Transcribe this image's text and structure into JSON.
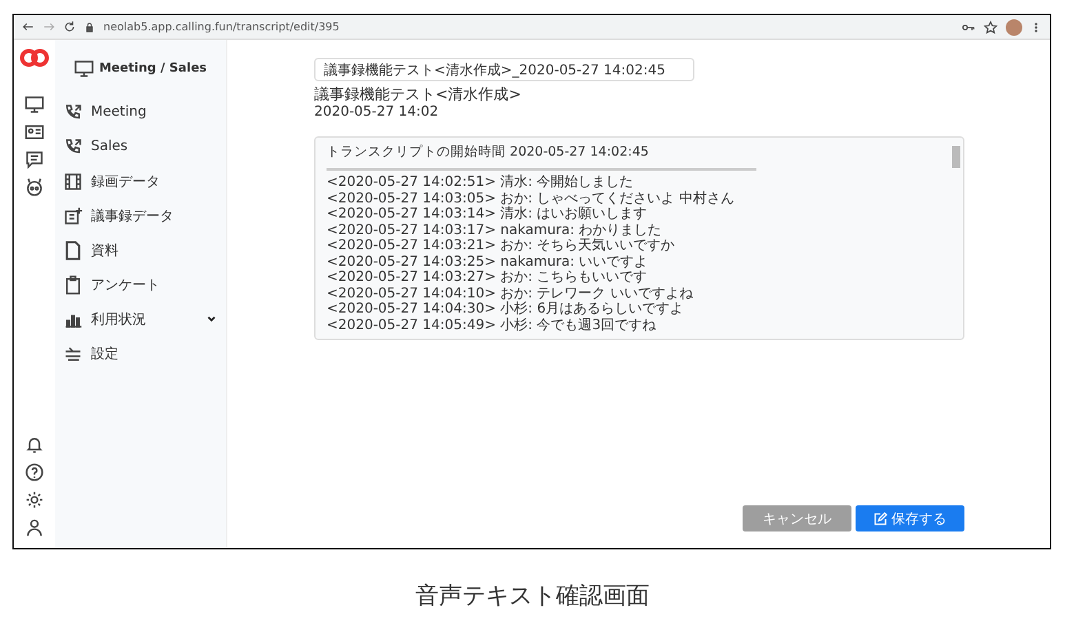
{
  "browser": {
    "url": "neolab5.app.calling.fun/transcript/edit/395"
  },
  "sidebar": {
    "title": "Meeting / Sales",
    "items": [
      {
        "label": "Meeting",
        "has_submenu": false
      },
      {
        "label": "Sales",
        "has_submenu": false
      },
      {
        "label": "録画データ",
        "has_submenu": false
      },
      {
        "label": "議事録データ",
        "has_submenu": false
      },
      {
        "label": "資料",
        "has_submenu": false
      },
      {
        "label": "アンケート",
        "has_submenu": false
      },
      {
        "label": "利用状況",
        "has_submenu": true
      },
      {
        "label": "設定",
        "has_submenu": false
      }
    ]
  },
  "editor": {
    "title_field": "議事録機能テスト<清水作成>_2020-05-27 14:02:45",
    "heading": "議事録機能テスト<清水作成>",
    "date": "2020-05-27 14:02",
    "transcript_header": "トランスクリプトの開始時間 2020-05-27 14:02:45",
    "lines": [
      "<2020-05-27 14:02:51> 清水: 今開始しました",
      "<2020-05-27 14:03:05> おか: しゃべってくださいよ 中村さん",
      "<2020-05-27 14:03:14> 清水: はいお願いします",
      "<2020-05-27 14:03:17> nakamura: わかりました",
      "<2020-05-27 14:03:21> おか: そちら天気いいですか",
      "<2020-05-27 14:03:25> nakamura: いいですよ",
      "<2020-05-27 14:03:27> おか: こちらもいいです",
      "<2020-05-27 14:04:10> おか: テレワーク いいですよね",
      "<2020-05-27 14:04:30> 小杉: 6月はあるらしいですよ",
      "<2020-05-27 14:05:49> 小杉: 今でも週3回ですね"
    ]
  },
  "buttons": {
    "cancel": "キャンセル",
    "save": "保存する"
  },
  "caption": "音声テキスト確認画面"
}
